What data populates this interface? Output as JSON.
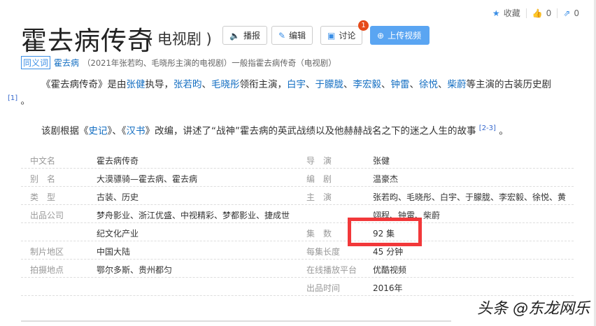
{
  "topbar": {
    "favorite": "收藏",
    "likes": "0",
    "shares": "0"
  },
  "title": "霍去病传奇",
  "subtitle": "( 电视剧 )",
  "buttons": {
    "broadcast": "播报",
    "edit": "编辑",
    "discuss": "讨论",
    "discuss_badge": "1",
    "upload": "上传视频"
  },
  "synonym": {
    "tag": "同义词",
    "link": "霍去病",
    "text": "（2021年张若昀、毛晓彤主演的电视剧）一般指霍去病传奇（电视剧）"
  },
  "para1": {
    "t1": "《霍去病传奇》是由",
    "director": "张健",
    "t2": "执导，",
    "a1": "张若昀",
    "s1": "、",
    "a2": "毛晓彤",
    "t3": "领衔主演，",
    "a3": "白宇",
    "a4": "于朦胧",
    "a5": "李宏毅",
    "a6": "钟雷",
    "a7": "徐悦",
    "a8": "柴蔚",
    "t4": "等主演的古装历史剧",
    "ref": "[1]",
    "end": "。"
  },
  "para2": {
    "t1": "该剧根据《",
    "b1": "史记",
    "t2": "》、《",
    "b2": "汉书",
    "t3": "》改编，讲述了“战神”霍去病的英武战绩以及他赫赫战名之下的迷之人生的故事",
    "ref": "[2-3]",
    "end": "。"
  },
  "info": [
    {
      "l1": "中文名",
      "v1": "霍去病传奇",
      "l2": "导　演",
      "v2": "张健"
    },
    {
      "l1": "别　名",
      "v1": "大漠骠骑—霍去病、霍去病",
      "l2": "编　剧",
      "v2": "温豪杰"
    },
    {
      "l1": "类　型",
      "v1": "古装、历史",
      "l2": "主　演",
      "v2": "张若昀、毛晓彤、白宇、于朦胧、李宏毅、徐悦、黄"
    },
    {
      "l1": "出品公司",
      "v1": "梦舟影业、浙江优盛、中视精彩、梦都影业、捷成世",
      "l2": "",
      "v2": "翊程、钟雷、柴蔚"
    },
    {
      "l1": "",
      "v1": "纪文化产业",
      "l2": "集　数",
      "v2": "92 集"
    },
    {
      "l1": "制片地区",
      "v1": "中国大陆",
      "l2": "每集长度",
      "v2": "45 分钟"
    },
    {
      "l1": "拍摄地点",
      "v1": "鄂尔多斯、贵州都匀",
      "l2": "在线播放平台",
      "v2": "优酷视频"
    },
    {
      "l1": "",
      "v1": "",
      "l2": "出品时间",
      "v2": "2016年"
    }
  ],
  "watermark": "头条 @东龙网乐"
}
